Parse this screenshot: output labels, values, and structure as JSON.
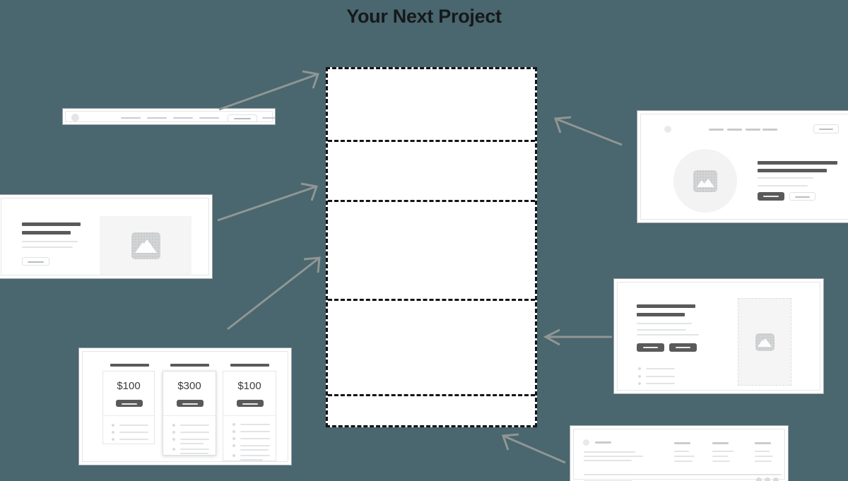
{
  "page": {
    "title": "Your Next Project",
    "background_color": "#4a666e",
    "title_color": "#15191b",
    "arrow_color": "#8f9694"
  },
  "canvas": {
    "name": "drop-canvas",
    "background_color": "#ffffff",
    "border_style": "dashed",
    "border_color": "#111418",
    "zone_count": 5,
    "zones": [
      {
        "label": ""
      },
      {
        "label": ""
      },
      {
        "label": ""
      },
      {
        "label": ""
      },
      {
        "label": ""
      }
    ]
  },
  "components": [
    {
      "id": "navbar",
      "name": "navbar-wireframe",
      "logo_icon": "circle-logo-icon",
      "nav_links": 4,
      "search_box": true,
      "trailing_link": true
    },
    {
      "id": "hero-split",
      "name": "hero-split-wireframe",
      "headings": 2,
      "text_lines": 2,
      "buttons": [
        {
          "style": "outline"
        }
      ],
      "image_icon": "image-placeholder-icon",
      "image_shape": "rectangle"
    },
    {
      "id": "pricing",
      "name": "pricing-wireframe",
      "cards": [
        {
          "price": "$100",
          "featured": false,
          "features": 3,
          "button_style": "filled"
        },
        {
          "price": "$300",
          "featured": true,
          "features": 5,
          "button_style": "filled"
        },
        {
          "price": "$100",
          "featured": false,
          "features": 7,
          "button_style": "filled"
        }
      ]
    },
    {
      "id": "hero-circle",
      "name": "hero-with-navbar-wireframe",
      "logo_icon": "circle-logo-icon",
      "nav_links": 4,
      "nav_button": true,
      "image_icon": "image-placeholder-icon",
      "image_shape": "circle",
      "headings": 2,
      "text_lines": 2,
      "buttons": [
        {
          "style": "filled"
        },
        {
          "style": "outline"
        }
      ]
    },
    {
      "id": "feature-split",
      "name": "feature-split-wireframe",
      "headings": 2,
      "text_lines": 3,
      "buttons": [
        {
          "style": "filled"
        },
        {
          "style": "filled"
        }
      ],
      "list_items": 3,
      "image_icon": "image-placeholder-icon",
      "image_shape": "portrait"
    },
    {
      "id": "footer",
      "name": "footer-wireframe",
      "logo_icon": "circle-logo-icon",
      "brand_bar": true,
      "description_lines": 3,
      "link_columns": 3,
      "links_per_column": 3,
      "divider": true,
      "copyright_bar": true,
      "social_icons": 3
    }
  ],
  "arrows": [
    {
      "name": "arrow-navbar-to-canvas",
      "from": "navbar",
      "to": "canvas",
      "direction": "up-right"
    },
    {
      "name": "arrow-hero-to-canvas",
      "from": "hero-split",
      "to": "canvas",
      "direction": "up-right"
    },
    {
      "name": "arrow-pricing-to-canvas",
      "from": "pricing",
      "to": "canvas",
      "direction": "up-right"
    },
    {
      "name": "arrow-herocircle-to-canvas",
      "from": "hero-circle",
      "to": "canvas",
      "direction": "up-left"
    },
    {
      "name": "arrow-feature-to-canvas",
      "from": "feature-split",
      "to": "canvas",
      "direction": "left"
    },
    {
      "name": "arrow-footer-to-canvas",
      "from": "footer",
      "to": "canvas",
      "direction": "up-left"
    }
  ]
}
